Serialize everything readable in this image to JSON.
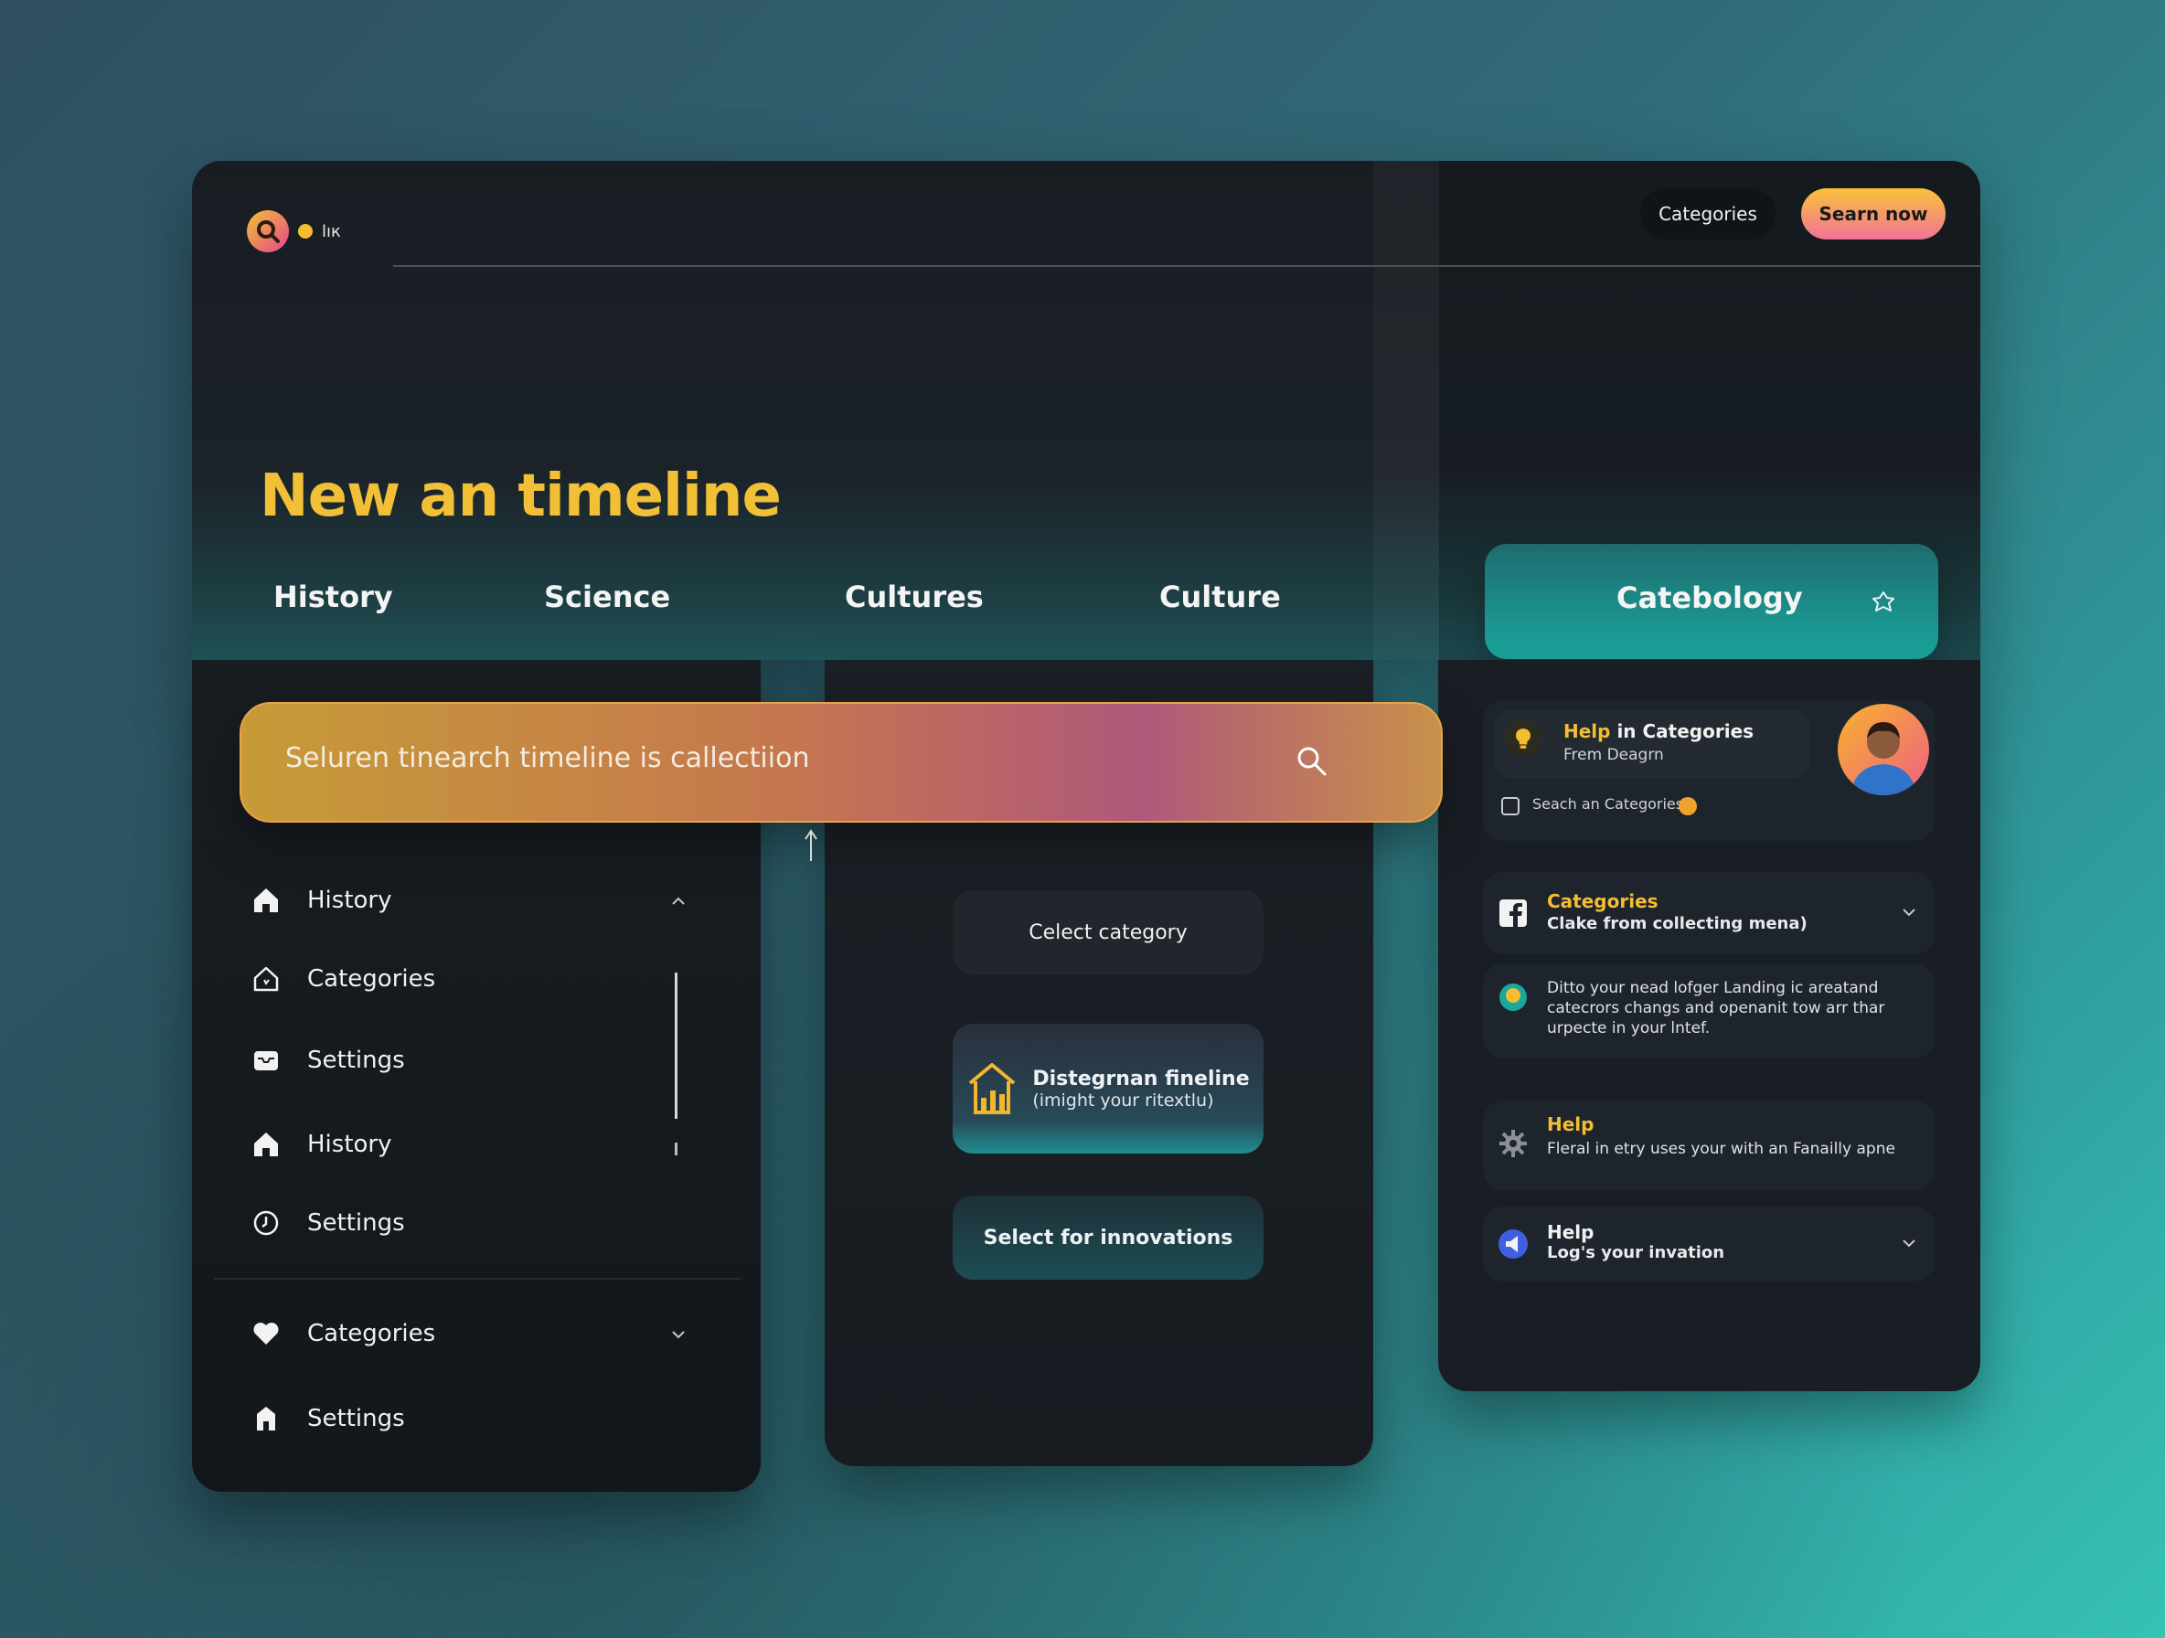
{
  "logo": {
    "text": "lıк"
  },
  "header": {
    "categories_button": "Categories",
    "learn_button": "Searn now",
    "title": "New an timeline"
  },
  "tabs": [
    {
      "label": "History"
    },
    {
      "label": "Science"
    },
    {
      "label": "Cultures"
    },
    {
      "label": "Culture"
    },
    {
      "label": "Catebology",
      "active": true,
      "icon": "refresh-icon"
    }
  ],
  "search": {
    "placeholder": "Seluren tinearch timeline is callectiion",
    "icon": "search-icon"
  },
  "sidebar": {
    "items": [
      {
        "label": "History",
        "icon": "home-icon",
        "expanded": true
      },
      {
        "label": "Categories",
        "icon": "house-outline-icon"
      },
      {
        "label": "Settings",
        "icon": "inbox-icon"
      },
      {
        "label": "History",
        "icon": "home-icon"
      },
      {
        "label": "Settings",
        "icon": "clock-icon"
      },
      {
        "label": "Categories",
        "icon": "heart-icon",
        "collapsed": true
      },
      {
        "label": "Settings",
        "icon": "building-icon"
      }
    ]
  },
  "middle": {
    "select_category": "Celect category",
    "featured_title": "Distegrnan fineline",
    "featured_subtitle": "(imight your ritextlu)",
    "select_innovations": "Select for innovations"
  },
  "right": {
    "help_card": {
      "title_highlight": "Help",
      "title_rest": " in Categories",
      "subtitle": "Frem Deagrn",
      "search_label": "Seach an Categories"
    },
    "categories_card": {
      "title": "Categories",
      "subtitle": "Clake from collecting mena)"
    },
    "info_card": {
      "text": "Ditto your nead lofger Landing ic areatand catecrors changs and openanit tow arr thar urpecte in your lntef."
    },
    "help_card2": {
      "title": "Help",
      "text": "Fleral in etry uses your with an Fanailly apne"
    },
    "help_card3": {
      "title": "Help",
      "subtitle": "Log's your invation"
    }
  },
  "colors": {
    "accent_yellow": "#f2c037",
    "teal": "#1aa79e",
    "panel": "#161b20"
  }
}
